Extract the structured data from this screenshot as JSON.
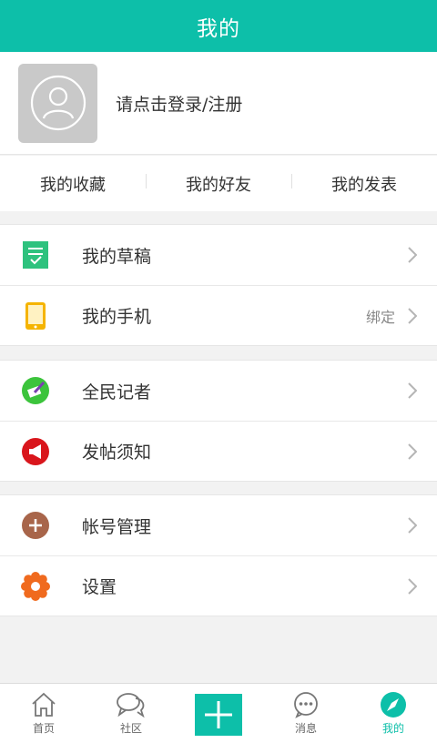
{
  "header": {
    "title": "我的"
  },
  "profile": {
    "login_prompt": "请点击登录/注册"
  },
  "quicklinks": [
    {
      "label": "我的收藏"
    },
    {
      "label": "我的好友"
    },
    {
      "label": "我的发表"
    }
  ],
  "groups": [
    {
      "items": [
        {
          "label": "我的草稿",
          "icon": "draft-icon"
        },
        {
          "label": "我的手机",
          "icon": "phone-icon",
          "value": "绑定"
        }
      ]
    },
    {
      "items": [
        {
          "label": "全民记者",
          "icon": "reporter-icon"
        },
        {
          "label": "发帖须知",
          "icon": "megaphone-icon"
        }
      ]
    },
    {
      "items": [
        {
          "label": "帐号管理",
          "icon": "account-plus-icon"
        },
        {
          "label": "设置",
          "icon": "gear-icon"
        }
      ]
    }
  ],
  "tabbar": {
    "items": [
      {
        "label": "首页",
        "icon": "home-icon"
      },
      {
        "label": "社区",
        "icon": "community-icon"
      },
      {
        "label": "",
        "icon": "plus-icon"
      },
      {
        "label": "消息",
        "icon": "message-icon"
      },
      {
        "label": "我的",
        "icon": "compass-icon",
        "active": true
      }
    ]
  },
  "colors": {
    "brand": "#0dbfa9",
    "draft": "#2ec27e",
    "phone": "#f5b400",
    "reporter": "#3cc43c",
    "notice": "#d9161c",
    "account": "#a8654a",
    "settings": "#f06a1e"
  }
}
